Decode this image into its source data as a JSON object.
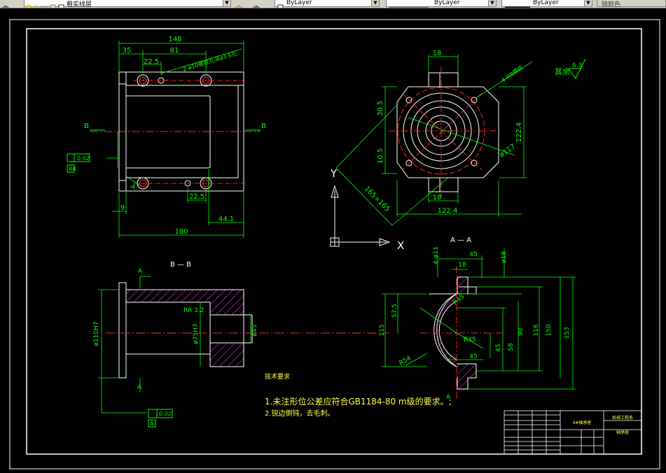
{
  "toolbar": {
    "layer_name": "粗实线层",
    "color_label": "ByLayer",
    "linetype_label": "ByLayer",
    "lineweight_label": "ByLayer",
    "plotstyle_label": "随颜色"
  },
  "drawing": {
    "top_view": {
      "dims": [
        "148",
        "35",
        "81",
        "22.5",
        "2-ø10螺纹孔深ø3.6孔",
        "B",
        "B",
        "0.02",
        "A",
        "R4",
        "22.5",
        "9",
        "44.1",
        "180"
      ]
    },
    "side_view": {
      "dims": [
        "18",
        "4-M8螺纹",
        "其余",
        "6.3",
        "30.5",
        "10.5",
        "122.4",
        "ø117",
        "165×165",
        "122.4",
        "18",
        "Y",
        "X"
      ]
    },
    "section_bb": {
      "title": "B — B",
      "dims": [
        "A",
        "ø110H7",
        "RA 3.2",
        "ø75H7",
        "ø45",
        "A",
        "0.02",
        "A"
      ]
    },
    "section_aa": {
      "title": "A — A",
      "dims": [
        "4-ø11",
        "45",
        "ø18",
        "18",
        "R45",
        "57.5",
        "115",
        "90",
        "116",
        "150",
        "153",
        "R45",
        "45",
        "58",
        "R54",
        "45",
        "A"
      ]
    },
    "notes": {
      "heading": "技术要求",
      "line1": "1.未注形位公差应符合GB1184-80 m级的要求。;",
      "line2": "2.锐边倒钝，去毛刺。"
    },
    "title_block": {
      "part_name": "4#轴承座",
      "school": "机械工程系",
      "drawing_no": "轴承座"
    }
  }
}
